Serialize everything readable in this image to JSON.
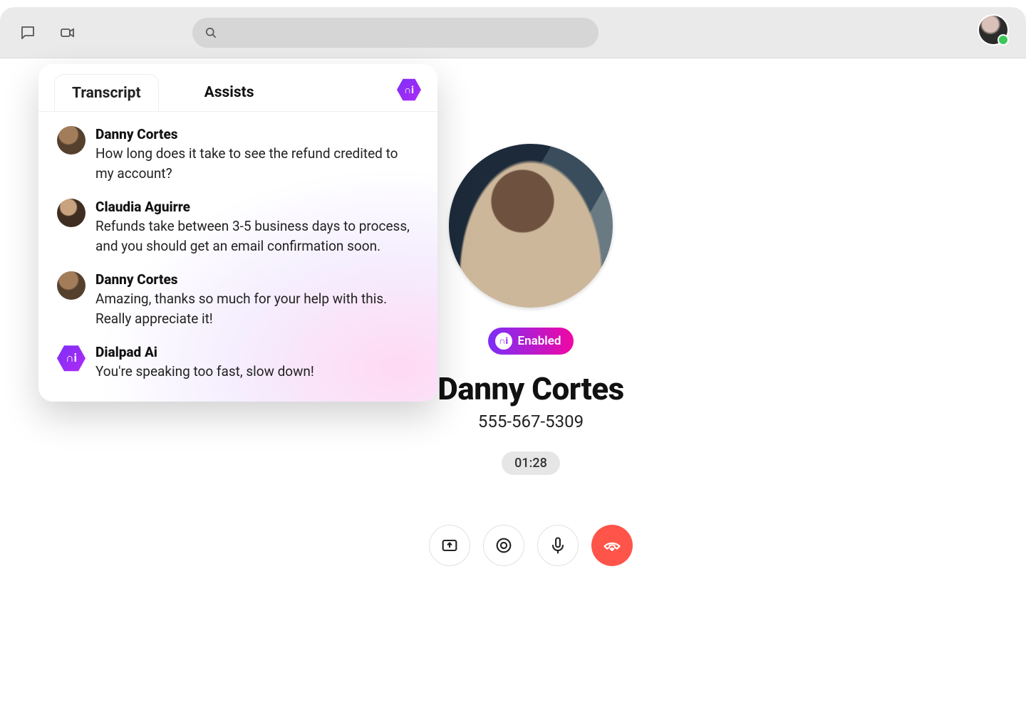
{
  "topbar": {
    "search_placeholder": ""
  },
  "panel": {
    "tabs": {
      "transcript": "Transcript",
      "assists": "Assists"
    },
    "active_tab": "transcript",
    "ai_badge_glyph": "∩i",
    "messages": [
      {
        "speaker": "Danny Cortes",
        "role": "customer",
        "text": "How long does it take to see the refund credited to my account?"
      },
      {
        "speaker": "Claudia Aguirre",
        "role": "agent",
        "text": "Refunds take between 3-5 business days to process, and you should get an email confirmation soon."
      },
      {
        "speaker": "Danny Cortes",
        "role": "customer",
        "text": "Amazing, thanks so much for your help with this. Really appreciate it!"
      },
      {
        "speaker": "Dialpad Ai",
        "role": "ai",
        "text": "You're speaking too fast, slow down!"
      }
    ]
  },
  "call": {
    "ai_enabled_label": "Enabled",
    "ai_badge_glyph": "∩i",
    "contact_name": "Danny Cortes",
    "contact_phone": "555-567-5309",
    "timer": "01:28"
  },
  "colors": {
    "grad_start": "#7b2ff7",
    "grad_end": "#f107a3",
    "end_call": "#ff5449",
    "presence_online": "#3ac859"
  }
}
